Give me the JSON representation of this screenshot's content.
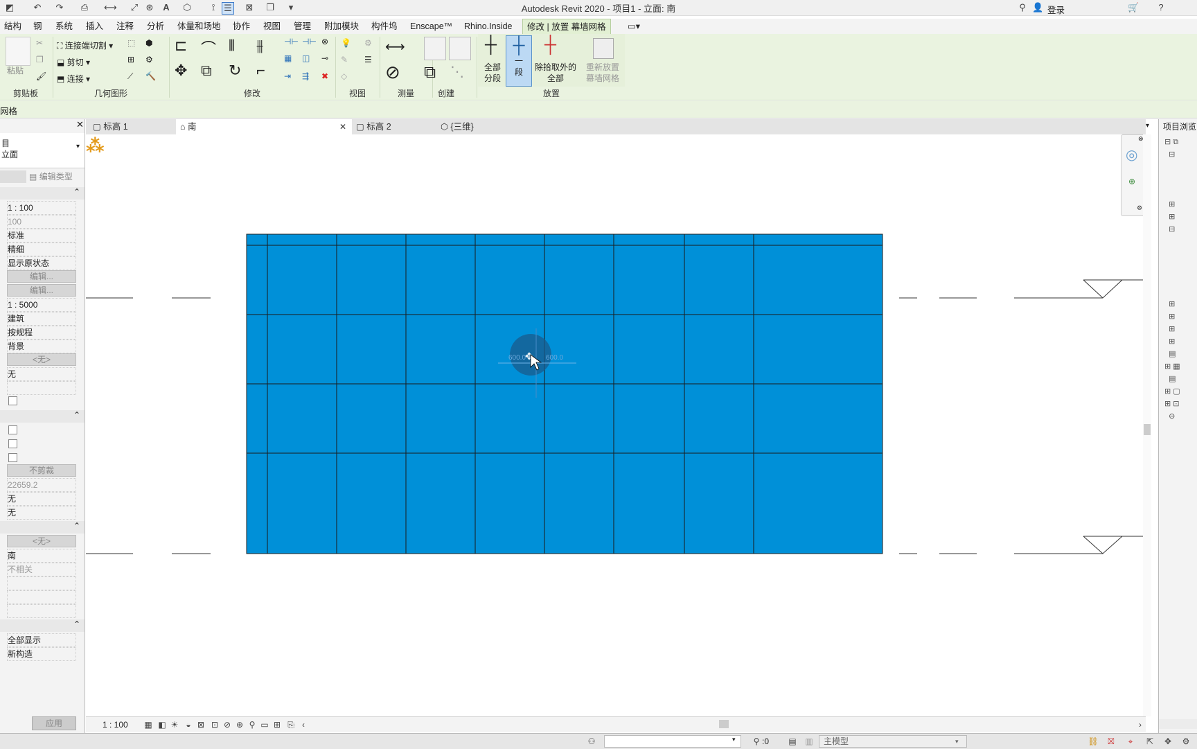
{
  "window": {
    "title": "Autodesk Revit 2020 - 项目1 - 立面: 南",
    "login": "登录"
  },
  "ribbon_tabs": [
    "结构",
    "钢",
    "系统",
    "插入",
    "注释",
    "分析",
    "体量和场地",
    "协作",
    "视图",
    "管理",
    "附加模块",
    "构件坞",
    "Enscape™",
    "Rhino.Inside",
    "修改 | 放置 幕墙网格"
  ],
  "ribbon": {
    "clipboard": {
      "paste": "粘贴",
      "label": "剪贴板"
    },
    "geometry": {
      "cut_join": "连接端切割",
      "cut": "剪切",
      "join": "连接",
      "label": "几何图形"
    },
    "modify": {
      "label": "修改"
    },
    "view": {
      "label": "视图"
    },
    "measure": {
      "label": "测量"
    },
    "create": {
      "label": "创建"
    },
    "place": {
      "all_segments_l1": "全部",
      "all_segments_l2": "分段",
      "one_segment_l1": "一",
      "one_segment_l2": "段",
      "all_except_l1": "除拾取外的",
      "all_except_l2": "全部",
      "relocate_l1": "重新放置",
      "relocate_l2": "幕墙网格",
      "label": "放置"
    }
  },
  "option_bar": {
    "text": "网格"
  },
  "properties": {
    "type_line1": "目",
    "type_line2": "立面",
    "edit_type": "编辑类型",
    "values": [
      "1 : 100",
      "100",
      "标准",
      "精细",
      "显示原状态",
      "编辑...",
      "编辑...",
      "1 : 5000",
      "建筑",
      "按规程",
      "背景",
      "<无>",
      "无"
    ],
    "values2": [
      "不剪裁",
      "22659.2",
      "无",
      "无"
    ],
    "values3": [
      "<无>",
      "南",
      "不相关"
    ],
    "values4": [
      "全部显示",
      "新构造"
    ],
    "apply": "应用"
  },
  "view_tabs": [
    {
      "label": "标高 1",
      "active": false
    },
    {
      "label": "南",
      "active": true
    },
    {
      "label": "标高 2",
      "active": false
    },
    {
      "label": "{三维}",
      "active": false
    }
  ],
  "canvas": {
    "dim_left": "600.0",
    "dim_right": "600.0",
    "curtain_color": "#0090d8"
  },
  "browser": {
    "title": "项目浏览器"
  },
  "view_control": {
    "scale": "1 : 100"
  },
  "status": {
    "count": ":0",
    "model": "主模型"
  }
}
